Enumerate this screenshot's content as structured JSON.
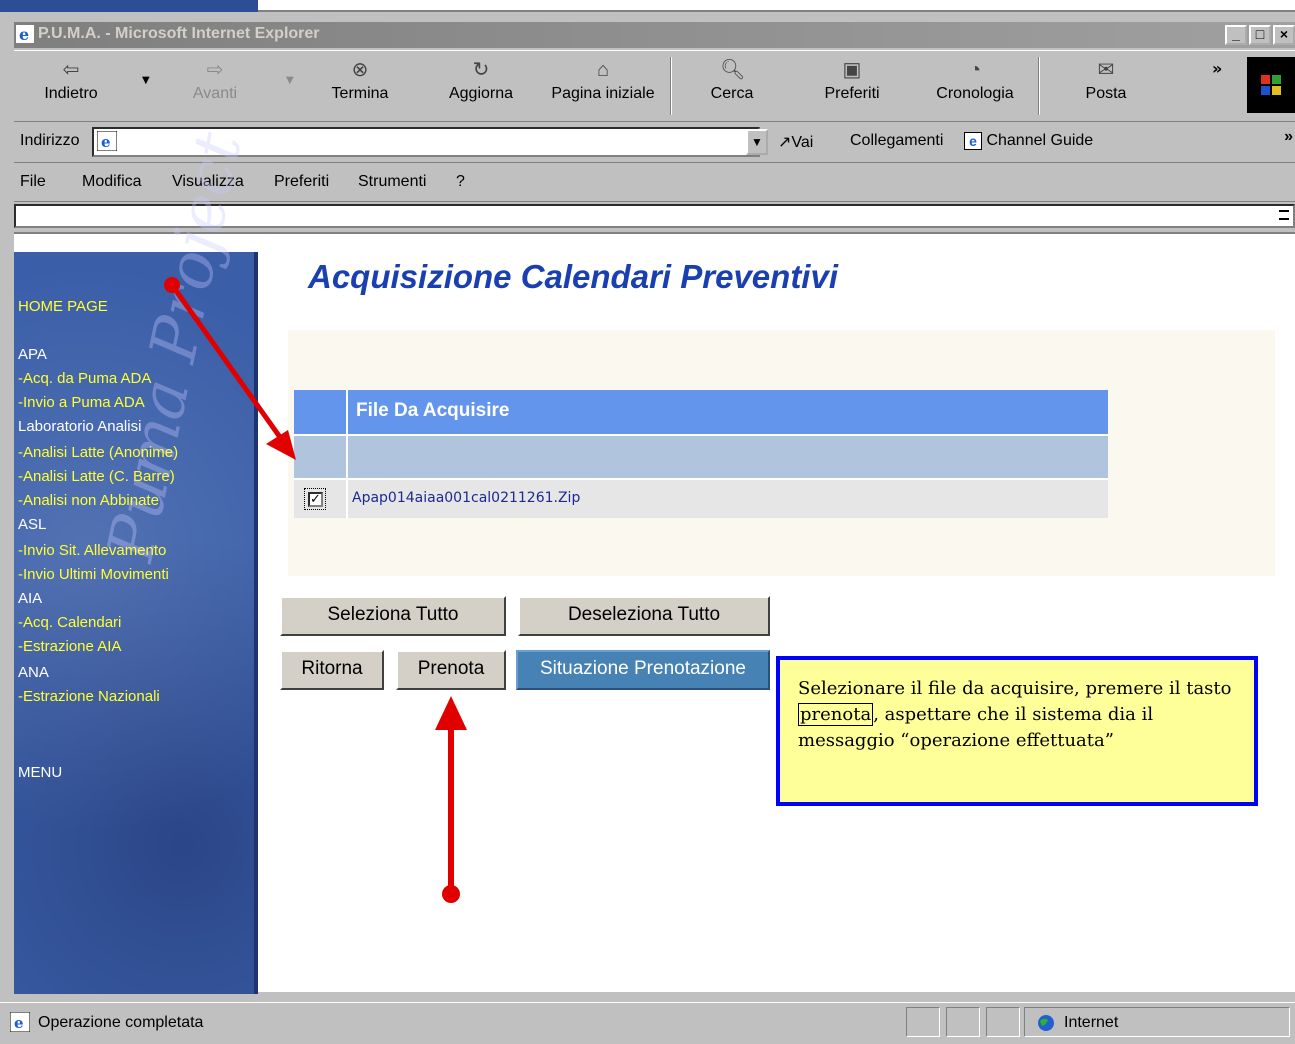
{
  "window": {
    "title": "P.U.M.A. - Microsoft Internet Explorer",
    "min": "_",
    "max": "□",
    "close": "×"
  },
  "toolbar": {
    "back": "Indietro",
    "forward": "Avanti",
    "stop": "Termina",
    "refresh": "Aggiorna",
    "home": "Pagina iniziale",
    "search": "Cerca",
    "favorites": "Preferiti",
    "history": "Cronologia",
    "mail": "Posta",
    "chevron": "»"
  },
  "address": {
    "label": "Indirizzo",
    "value": "",
    "go": "Vai",
    "links": "Collegamenti",
    "channel": "Channel Guide",
    "chevron": "»"
  },
  "menu": {
    "file": "File",
    "edit": "Modifica",
    "view": "Visualizza",
    "favorites": "Preferiti",
    "tools": "Strumenti",
    "help": "?"
  },
  "sidebar": {
    "home": "HOME PAGE",
    "apa": "APA",
    "apa_acq": "-Acq. da Puma ADA",
    "apa_invio": "-Invio a Puma ADA",
    "lab": "Laboratorio Analisi",
    "lab_anon": "-Analisi Latte (Anonime)",
    "lab_barre": "-Analisi Latte (C. Barre)",
    "lab_non": "-Analisi non Abbinate",
    "asl": "ASL",
    "asl_sit": "-Invio Sit. Allevamento",
    "asl_mov": "-Invio Ultimi Movimenti",
    "aia": "AIA",
    "aia_acq": "-Acq. Calendari",
    "aia_estr": "-Estrazione AIA",
    "ana": "ANA",
    "ana_estr": "-Estrazione Nazionali",
    "menu": "MENU",
    "art": "Puma Project"
  },
  "main": {
    "title": "Acquisizione Calendari Preventivi",
    "table_header": "File Da Acquisire",
    "file_name": "Apap014aiaa001cal0211261.Zip",
    "file_checked": true,
    "check_mark": "✓"
  },
  "buttons": {
    "select_all": "Seleziona Tutto",
    "deselect_all": "Deseleziona Tutto",
    "back": "Ritorna",
    "book": "Prenota",
    "status": "Situazione Prenotazione"
  },
  "note": {
    "part1": "Selezionare il file da acquisire,  premere il tasto ",
    "boxed": "prenota",
    "part2": ", aspettare che il sistema dia il messaggio “operazione effettuata”"
  },
  "status": {
    "text": "Operazione completata",
    "zone": "Internet"
  },
  "colors": {
    "title_blue": "#1a3fb0",
    "header_blue": "#6495ed",
    "arrow_red": "#e00000",
    "note_bg": "#ffff99",
    "note_border": "#0000ff"
  }
}
